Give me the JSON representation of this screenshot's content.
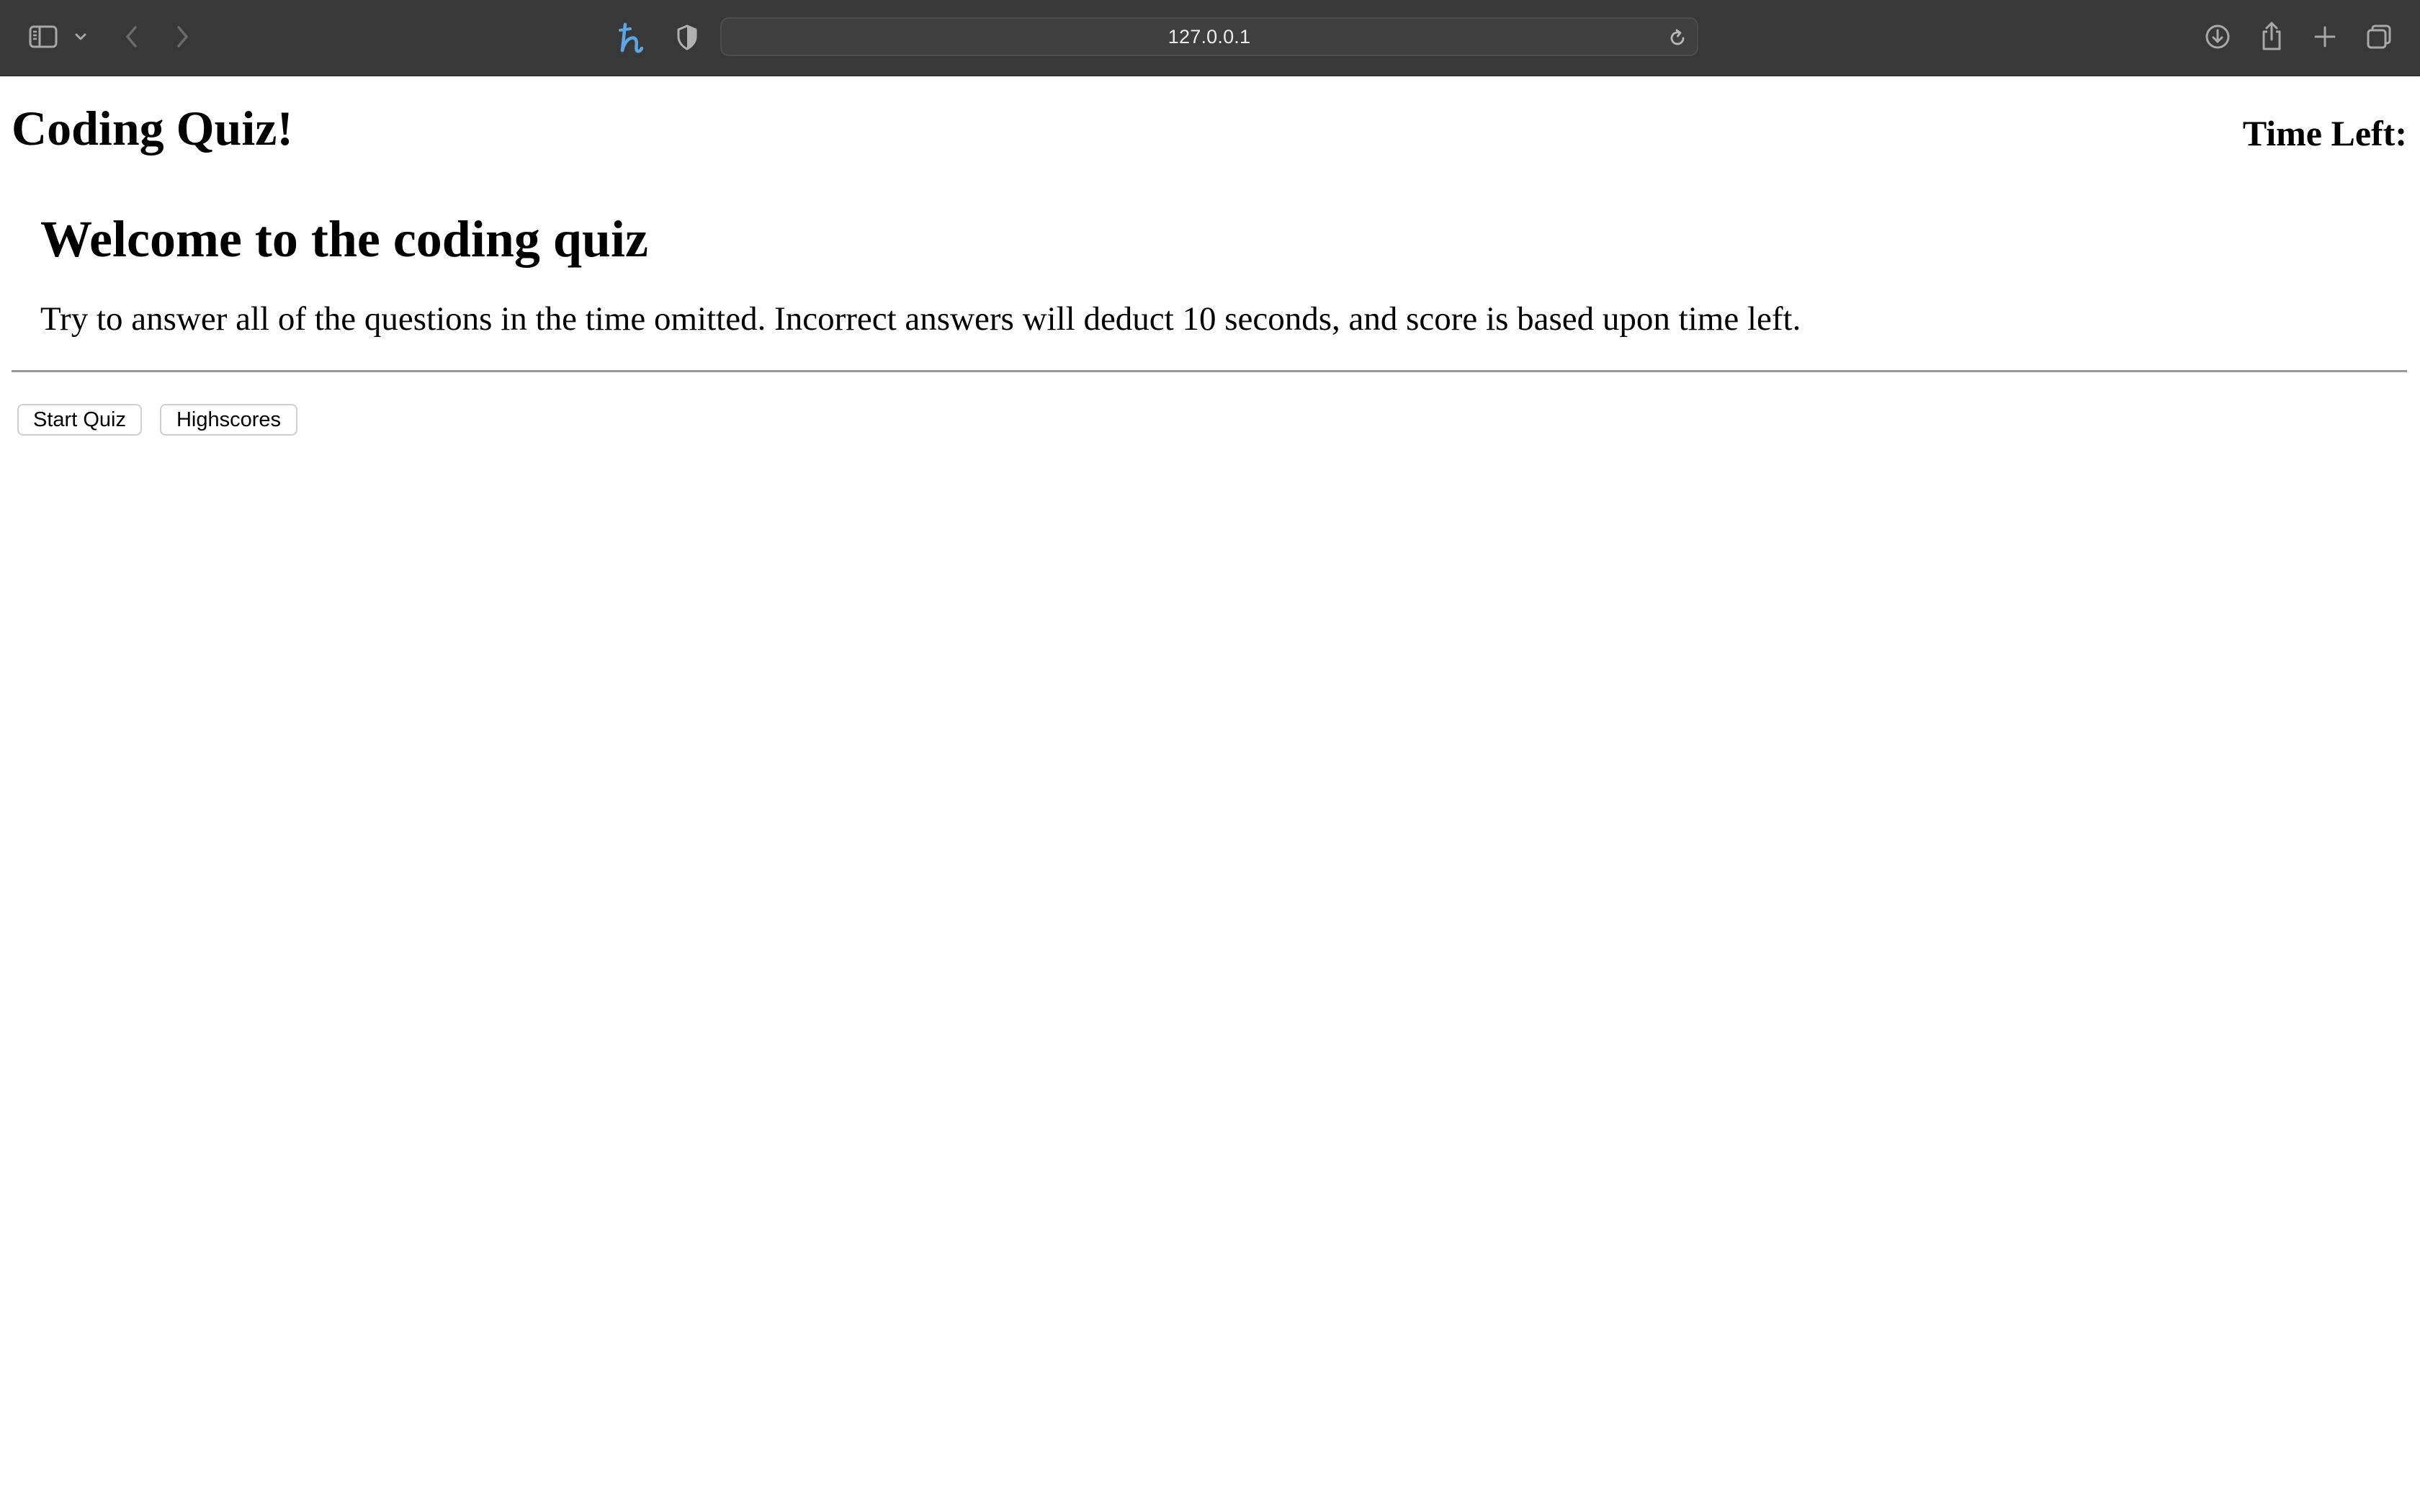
{
  "browser": {
    "url": "127.0.0.1",
    "icons": {
      "sidebar": "sidebar-icon",
      "sidebar_menu": "chevron-down-icon",
      "back": "chevron-left-icon",
      "forward": "chevron-right-icon",
      "extension": "honey-extension-icon",
      "privacy": "shield-icon",
      "reload": "reload-icon",
      "downloads": "download-icon",
      "share": "share-icon",
      "new_tab": "plus-icon",
      "tab_overview": "tabs-overview-icon"
    },
    "colors": {
      "toolbar": "#383838",
      "extension_accent": "#5aa6e6"
    }
  },
  "page": {
    "title": "Coding Quiz!",
    "timer_label": "Time Left:",
    "welcome_heading": "Welcome to the coding quiz",
    "intro_text": "Try to answer all of the questions in the time omitted. Incorrect answers will deduct 10 seconds, and score is based upon time left.",
    "buttons": {
      "start": "Start Quiz",
      "highscores": "Highscores"
    }
  }
}
